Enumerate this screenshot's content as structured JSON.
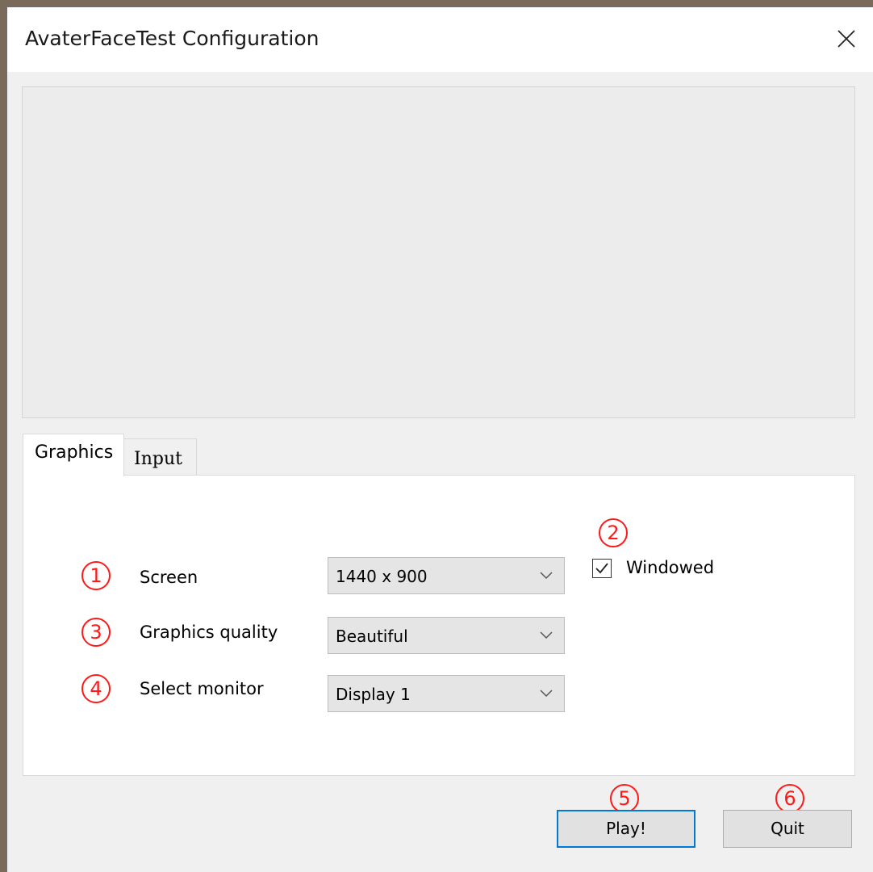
{
  "window": {
    "title": "AvaterFaceTest Configuration",
    "close_glyph": "×"
  },
  "tabs": [
    {
      "label": "Graphics",
      "active": true
    },
    {
      "label": "Input",
      "active": false
    }
  ],
  "graphics": {
    "screen": {
      "label": "Screen",
      "value": "1440 x 900"
    },
    "quality": {
      "label": "Graphics quality",
      "value": "Beautiful"
    },
    "monitor": {
      "label": "Select monitor",
      "value": "Display 1"
    },
    "windowed": {
      "label": "Windowed",
      "checked": true
    }
  },
  "buttons": {
    "play": "Play!",
    "quit": "Quit"
  },
  "markers": [
    "1",
    "2",
    "3",
    "4",
    "5",
    "6"
  ],
  "colors": {
    "marker": "#ff1a1a",
    "default_button_border": "#0078d7",
    "dialog_bg": "#f0f0f0"
  },
  "icons": {
    "close": "close-icon",
    "dropdown": "chevron-down-icon",
    "check": "checkmark-icon"
  }
}
